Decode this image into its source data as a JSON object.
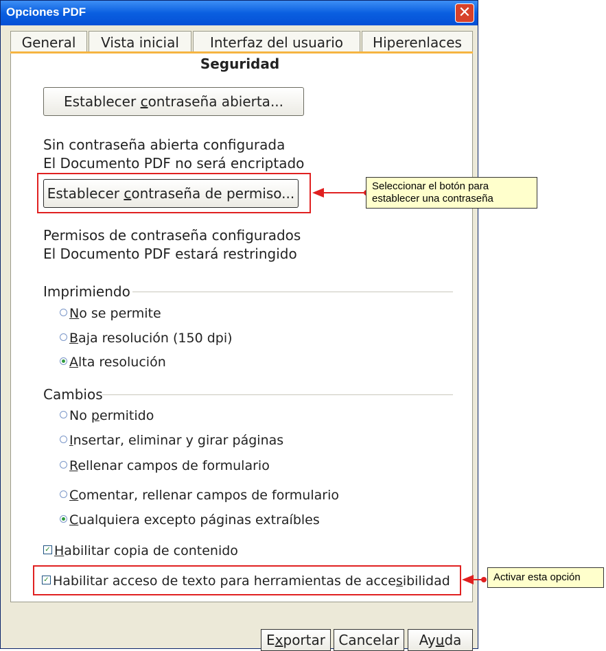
{
  "window": {
    "title": "Opciones PDF",
    "close_glyph": "✕"
  },
  "tabs": [
    {
      "label": "General"
    },
    {
      "label": "Vista inicial"
    },
    {
      "label": "Interfaz del usuario"
    },
    {
      "label": "Hiperenlaces"
    }
  ],
  "security": {
    "heading": "Seguridad",
    "open_password_button": {
      "pre": "Establecer ",
      "accel": "c",
      "post": "ontraseña abierta..."
    },
    "open_status_line1": "Sin contraseña abierta configurada",
    "open_status_line2": "El Documento PDF no será encriptado",
    "permission_password_button": {
      "pre": "Establecer ",
      "accel": "c",
      "post": "ontraseña de permiso..."
    },
    "perm_status_line1": "Permisos de contraseña configurados",
    "perm_status_line2": "El Documento PDF estará restringido"
  },
  "printing": {
    "label": "Imprimiendo",
    "options": [
      {
        "accel": "N",
        "rest": "o se permite",
        "selected": false
      },
      {
        "accel": "B",
        "rest": "aja resolución (150 dpi)",
        "selected": false
      },
      {
        "accel": "A",
        "rest": "lta resolución",
        "selected": true
      }
    ]
  },
  "changes": {
    "label": "Cambios",
    "options": [
      {
        "pre": "No ",
        "accel": "p",
        "rest": "ermitido",
        "selected": false
      },
      {
        "pre": "",
        "accel": "I",
        "rest": "nsertar, eliminar y girar páginas",
        "selected": false
      },
      {
        "pre": "",
        "accel": "R",
        "rest": "ellenar campos de formulario",
        "selected": false
      },
      {
        "pre": "",
        "accel": "C",
        "rest": "omentar, rellenar campos de formulario",
        "selected": false
      },
      {
        "pre": "",
        "accel": "C",
        "rest": "ualquiera excepto páginas extraíbles",
        "selected": true
      }
    ]
  },
  "checkboxes": {
    "copy": {
      "accel": "H",
      "rest": "abilitar copia de contenido",
      "checked": true
    },
    "accessibility": {
      "pre": "Habilitar acceso de texto para herramientas de acce",
      "accel": "s",
      "post": "ibilidad",
      "checked": true
    }
  },
  "footer": {
    "export": {
      "pre": "E",
      "accel": "x",
      "post": "portar"
    },
    "cancel": "Cancelar",
    "help": {
      "pre": "Ay",
      "accel": "u",
      "post": "da"
    }
  },
  "callouts": {
    "button_hint": "Seleccionar el botón para establecer una contraseña",
    "option_hint": "Activar esta opción"
  },
  "colors": {
    "highlight": "#e02020",
    "callout_bg": "#ffffcc",
    "titlebar": "#0a5fe0"
  }
}
